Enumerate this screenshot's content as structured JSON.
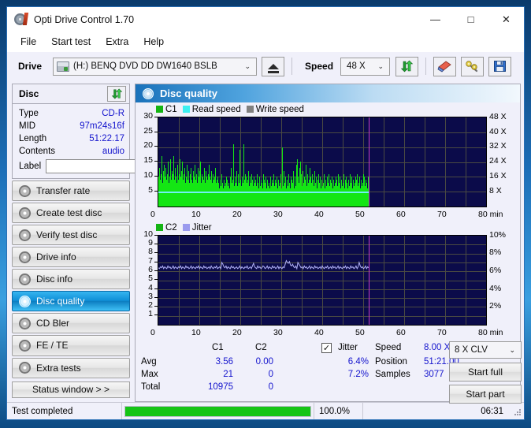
{
  "window": {
    "title": "Opti Drive Control 1.70",
    "icon": "disc-icon",
    "minimize": "—",
    "maximize": "□",
    "close": "✕"
  },
  "menu": {
    "items": [
      {
        "label": "File"
      },
      {
        "label": "Start test"
      },
      {
        "label": "Extra"
      },
      {
        "label": "Help"
      }
    ]
  },
  "toolbar": {
    "drive_label": "Drive",
    "drive_value": "(H:)  BENQ DVD DD DW1640 BSLB",
    "eject_icon": "eject-icon",
    "speed_label": "Speed",
    "speed_value": "48 X",
    "refresh_icon": "refresh-icon",
    "eraser_icon": "eraser-icon",
    "tools_icon": "tools-icon",
    "save_icon": "save-icon",
    "chevron": "⌄"
  },
  "sidebar": {
    "disc_panel": {
      "title": "Disc",
      "refresh_icon": "refresh-icon",
      "rows": [
        {
          "key": "Type",
          "value": "CD-R"
        },
        {
          "key": "MID",
          "value": "97m24s16f"
        },
        {
          "key": "Length",
          "value": "51:22.17"
        },
        {
          "key": "Contents",
          "value": "audio"
        }
      ],
      "label_key": "Label",
      "label_value": "",
      "label_placeholder": "",
      "disc_icon": "cd-disc-icon"
    },
    "items": [
      {
        "label": "Transfer rate",
        "icon": "disc-icon",
        "active": false
      },
      {
        "label": "Create test disc",
        "icon": "disc-icon",
        "active": false
      },
      {
        "label": "Verify test disc",
        "icon": "disc-icon",
        "active": false
      },
      {
        "label": "Drive info",
        "icon": "disc-icon",
        "active": false
      },
      {
        "label": "Disc info",
        "icon": "disc-icon",
        "active": false
      },
      {
        "label": "Disc quality",
        "icon": "disc-icon",
        "active": true
      },
      {
        "label": "CD Bler",
        "icon": "disc-icon",
        "active": false
      },
      {
        "label": "FE / TE",
        "icon": "disc-icon",
        "active": false
      },
      {
        "label": "Extra tests",
        "icon": "disc-icon",
        "active": false
      }
    ],
    "status_window_button": "Status window > >"
  },
  "main": {
    "header": "Disc quality",
    "header_icon": "disc-quality-icon"
  },
  "stats": {
    "col_c1": "C1",
    "col_c2": "C2",
    "row_avg": "Avg",
    "row_max": "Max",
    "row_total": "Total",
    "c1_avg": "3.56",
    "c1_max": "21",
    "c1_total": "10975",
    "c2_avg": "0.00",
    "c2_max": "0",
    "c2_total": "0",
    "jitter_label": "Jitter",
    "jitter_checked": "✓",
    "jitter_avg": "6.4%",
    "jitter_max": "7.2%",
    "speed_label": "Speed",
    "speed_value": "8.00 X",
    "position_label": "Position",
    "position_value": "51:21.00",
    "samples_label": "Samples",
    "samples_value": "3077",
    "clv_value": "8 X CLV",
    "clv_chevron": "⌄",
    "start_full": "Start full",
    "start_part": "Start part"
  },
  "statusbar": {
    "text": "Test completed",
    "percent": "100.0%",
    "progress": 100,
    "time": "06:31"
  },
  "chart_data": [
    {
      "type": "bar",
      "name": "c1-chart",
      "title": "",
      "xlabel": "min",
      "ylabel": "",
      "xlim": [
        0,
        80
      ],
      "ylim": [
        0,
        30
      ],
      "xticks": [
        0,
        10,
        20,
        30,
        40,
        50,
        60,
        70,
        80
      ],
      "yticks": [
        5,
        10,
        15,
        20,
        25,
        30
      ],
      "y2ticks": [
        "8 X",
        "16 X",
        "24 X",
        "32 X",
        "40 X",
        "48 X"
      ],
      "y2lim": [
        0,
        48
      ],
      "grid": true,
      "legend": [
        {
          "label": "C1",
          "color": "#14b414"
        },
        {
          "label": "Read speed",
          "color": "#3cf0f0"
        },
        {
          "label": "Write speed",
          "color": "#808080"
        }
      ],
      "data_end_x": 51.35,
      "marker_x": 51.35,
      "marker_color": "#c83cc8",
      "read_speed_level": 5.0,
      "series": [
        {
          "name": "C1",
          "color": "#14e614",
          "values": [
            10,
            13,
            9,
            11,
            17,
            8,
            12,
            9,
            14,
            10,
            13,
            9,
            11,
            15,
            8,
            10,
            16,
            9,
            12,
            8,
            11,
            17,
            9,
            13,
            10,
            8,
            14,
            9,
            11,
            16,
            10,
            12,
            8,
            15,
            9,
            11,
            13,
            8,
            10,
            14,
            9,
            12,
            8,
            11,
            10,
            13,
            9,
            8,
            12,
            10,
            14,
            9,
            11,
            8,
            13,
            10,
            12,
            9,
            15,
            8,
            11,
            10,
            9,
            13,
            8,
            12,
            10,
            9,
            11,
            8,
            14,
            10,
            9,
            12,
            8,
            11,
            9,
            10,
            13,
            8,
            9,
            7,
            10,
            8,
            6,
            9,
            7,
            11,
            8,
            6,
            9,
            7,
            8,
            10,
            6,
            9,
            7,
            8,
            6,
            10,
            13,
            8,
            9,
            21,
            7,
            10,
            8,
            12,
            9,
            7,
            11,
            8,
            19,
            9,
            7,
            10,
            8,
            21,
            9,
            11,
            7,
            10,
            8,
            9,
            12,
            7,
            10,
            8,
            11,
            9,
            7,
            10,
            8,
            6,
            9,
            7,
            11,
            8,
            6,
            10,
            7,
            9,
            8,
            6,
            11,
            7,
            9,
            8,
            10,
            6,
            9,
            7,
            8,
            6,
            10,
            7,
            9,
            8,
            6,
            11,
            7,
            9,
            8,
            10,
            6,
            9,
            7,
            8,
            11,
            6,
            20,
            9,
            7,
            12,
            8,
            10,
            6,
            9,
            7,
            11,
            8,
            6,
            10,
            7,
            9,
            8,
            12,
            6,
            10,
            7,
            14,
            16,
            10,
            8,
            13,
            15,
            9,
            11,
            7,
            12,
            8,
            10,
            9,
            14,
            7,
            11,
            8,
            9,
            13,
            7,
            10,
            8,
            11,
            9,
            7,
            12,
            8,
            10,
            6,
            9,
            7,
            11,
            8,
            10,
            6,
            9,
            7,
            8,
            11,
            6,
            9,
            7,
            10,
            8,
            6,
            11,
            7,
            9,
            8,
            10,
            6,
            9,
            7,
            8,
            10,
            6,
            9,
            7,
            11,
            8,
            10,
            6,
            9,
            7,
            8,
            11,
            6,
            9,
            7,
            10,
            8,
            6,
            9,
            7,
            11,
            8,
            10,
            6,
            9,
            7,
            8,
            10,
            6,
            9,
            11,
            7,
            8,
            10,
            6,
            9,
            7,
            8,
            11,
            6,
            10,
            7,
            9,
            8,
            6,
            10
          ]
        }
      ]
    },
    {
      "type": "line",
      "name": "c2-jitter-chart",
      "title": "",
      "xlabel": "min",
      "ylabel": "",
      "xlim": [
        0,
        80
      ],
      "ylim": [
        0,
        10
      ],
      "xticks": [
        0,
        10,
        20,
        30,
        40,
        50,
        60,
        70,
        80
      ],
      "yticks": [
        1,
        2,
        3,
        4,
        5,
        6,
        7,
        8,
        9,
        10
      ],
      "y2ticks": [
        "2%",
        "4%",
        "6%",
        "8%",
        "10%"
      ],
      "y2lim": [
        0,
        10
      ],
      "grid": true,
      "legend": [
        {
          "label": "C2",
          "color": "#14b414"
        },
        {
          "label": "Jitter",
          "color": "#9a9aee"
        }
      ],
      "data_end_x": 51.35,
      "marker_x": 51.35,
      "marker_color": "#c83cc8",
      "series": [
        {
          "name": "Jitter",
          "color": "#b0b0f5",
          "values": [
            6.4,
            6.3,
            6.5,
            6.4,
            6.6,
            6.3,
            6.5,
            6.4,
            6.3,
            6.6,
            6.4,
            6.5,
            6.3,
            6.4,
            6.6,
            6.3,
            6.5,
            6.4,
            6.3,
            6.5,
            6.4,
            6.6,
            6.3,
            6.5,
            6.4,
            6.3,
            6.6,
            6.4,
            6.5,
            6.3,
            6.4,
            6.6,
            6.3,
            6.5,
            6.4,
            6.3,
            6.5,
            6.4,
            6.6,
            6.3,
            6.5,
            6.4,
            6.3,
            6.6,
            6.4,
            6.5,
            6.3,
            6.4,
            6.5,
            6.3,
            6.6,
            6.4,
            6.3,
            6.5,
            6.4,
            6.6,
            6.3,
            6.4,
            6.5,
            6.3,
            7.0,
            6.8,
            6.5,
            6.4,
            6.6,
            6.3,
            6.5,
            6.4,
            6.3,
            6.6,
            6.4,
            6.5,
            6.3,
            6.4,
            6.5,
            6.3,
            6.4,
            6.6,
            6.3,
            6.5,
            6.4,
            6.3,
            6.5,
            6.4,
            6.6,
            6.3,
            6.4,
            6.5,
            6.3,
            6.6,
            6.9,
            6.5,
            6.4,
            6.3,
            6.6,
            6.4,
            6.5,
            6.3,
            6.4,
            6.6,
            6.5,
            6.3,
            6.4,
            6.6,
            6.3,
            6.5,
            6.4,
            6.3,
            6.6,
            6.4,
            6.5,
            6.3,
            6.4,
            6.6,
            6.3,
            6.5,
            6.4,
            6.3,
            6.5,
            6.4,
            6.8,
            7.2,
            7.0,
            6.9,
            7.1,
            6.7,
            6.6,
            6.8,
            6.5,
            6.4,
            6.6,
            6.3,
            7.0,
            6.8,
            6.6,
            6.4,
            6.5,
            6.3,
            6.6,
            6.4,
            6.5,
            6.3,
            6.4,
            6.6,
            6.3,
            6.5,
            6.4,
            6.3,
            6.6,
            6.4,
            6.5,
            6.3,
            6.4,
            6.5,
            6.3,
            6.6,
            6.4,
            6.3,
            6.5,
            6.4,
            6.6,
            6.3,
            6.4,
            6.5,
            6.3,
            6.6,
            6.4,
            6.5,
            6.3,
            6.4,
            6.6,
            6.3,
            6.5,
            6.4,
            6.3,
            6.5,
            6.4,
            6.6,
            6.3,
            6.5,
            6.4,
            6.3,
            6.6,
            6.4,
            6.5,
            6.3,
            6.4,
            6.6,
            6.3,
            6.5,
            7.0,
            6.6,
            6.4,
            6.5,
            6.3,
            6.4,
            6.6,
            6.3,
            6.5,
            6.4
          ]
        }
      ]
    }
  ]
}
